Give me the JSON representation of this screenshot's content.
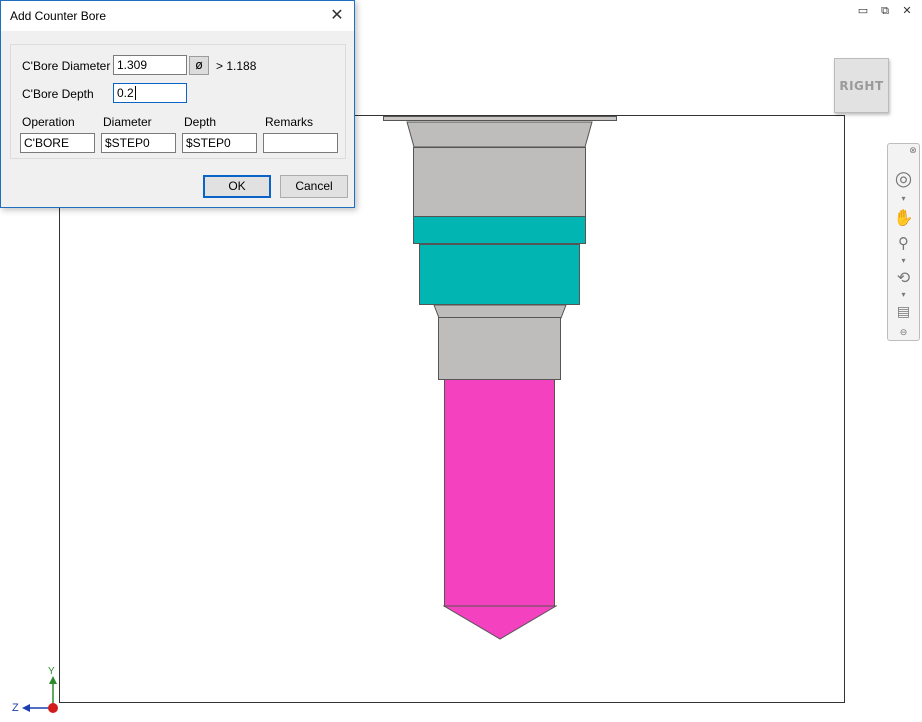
{
  "dialog": {
    "title": "Add Counter Bore",
    "close_glyph": "✕",
    "diameter_label": "C'Bore Diameter",
    "diameter_value": "1.309",
    "diameter_button": "ø",
    "diameter_hint": "> 1.188",
    "depth_label": "C'Bore Depth",
    "depth_value": "0.2",
    "columns": {
      "operation": "Operation",
      "diameter": "Diameter",
      "depth": "Depth",
      "remarks": "Remarks"
    },
    "row": {
      "operation": "C'BORE",
      "diameter": "$STEP0",
      "depth": "$STEP0",
      "remarks": ""
    },
    "ok_label": "OK",
    "cancel_label": "Cancel"
  },
  "window_controls": {
    "minimize": "▭",
    "restore": "⧉",
    "close": "✕"
  },
  "viewcube": {
    "face_label": "RIGHT"
  },
  "axis": {
    "y_label": "Y",
    "z_label": "Z"
  },
  "navbar": {
    "icons": [
      "close-icon",
      "steering-wheel-icon",
      "chevron-down-icon",
      "pan-icon",
      "zoom-icon",
      "chevron-down-icon",
      "orbit-icon",
      "chevron-down-icon",
      "showmotion-icon",
      "menu-icon"
    ]
  },
  "colors": {
    "gray_section": "#bfbdbc",
    "teal_section": "#00b5b2",
    "magenta_section": "#f441bf",
    "dialog_border": "#1f6fc0"
  }
}
